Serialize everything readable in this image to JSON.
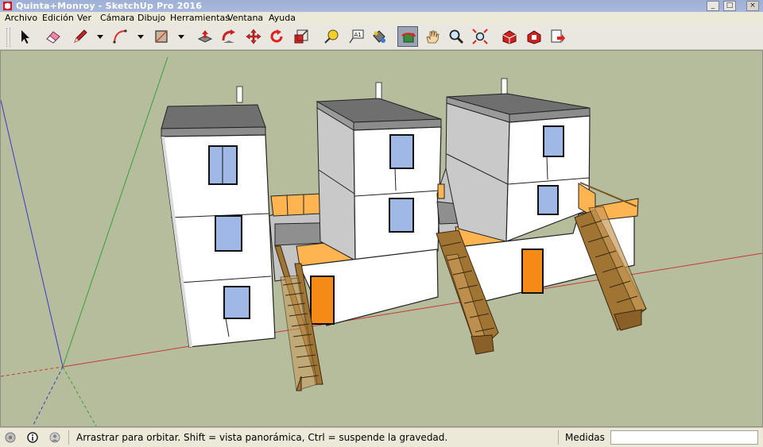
{
  "window": {
    "title": "Quinta+Monroy - SketchUp Pro 2016",
    "app_icon": "sketchup-logo",
    "controls": [
      "minimize",
      "maximize",
      "close"
    ],
    "control_glyphs": {
      "minimize": "_",
      "maximize": "□",
      "close": "×"
    }
  },
  "menu": {
    "items": [
      "Archivo",
      "Edición",
      "Ver",
      "Cámara",
      "Dibujo",
      "Herramientas",
      "Ventana",
      "Ayuda"
    ]
  },
  "toolbar": {
    "tools": [
      {
        "name": "select",
        "icon": "select-arrow-icon"
      },
      {
        "name": "eraser",
        "icon": "eraser-icon"
      },
      {
        "name": "line",
        "icon": "pencil-icon",
        "has_dropdown": true
      },
      {
        "name": "arc",
        "icon": "arc-icon",
        "has_dropdown": true
      },
      {
        "name": "rectangle",
        "icon": "rectangle-icon",
        "has_dropdown": true
      },
      {
        "name": "push-pull",
        "icon": "push-pull-icon"
      },
      {
        "name": "offset",
        "icon": "offset-icon"
      },
      {
        "name": "move",
        "icon": "move-icon"
      },
      {
        "name": "rotate",
        "icon": "rotate-icon"
      },
      {
        "name": "scale",
        "icon": "scale-icon"
      },
      {
        "name": "tape-measure",
        "icon": "tape-measure-icon"
      },
      {
        "name": "text",
        "icon": "text-icon",
        "label": "A1"
      },
      {
        "name": "paint-bucket",
        "icon": "paint-bucket-icon"
      },
      {
        "name": "orbit",
        "icon": "orbit-icon",
        "active": true
      },
      {
        "name": "pan",
        "icon": "pan-hand-icon"
      },
      {
        "name": "zoom",
        "icon": "zoom-icon"
      },
      {
        "name": "zoom-extents",
        "icon": "zoom-extents-icon"
      },
      {
        "name": "3d-warehouse",
        "icon": "warehouse-icon"
      },
      {
        "name": "extension-warehouse",
        "icon": "extension-warehouse-icon"
      },
      {
        "name": "layout",
        "icon": "send-to-layout-icon"
      }
    ]
  },
  "viewport": {
    "background": "#b6bd9d",
    "model": "Quinta+Monroy housing blocks"
  },
  "status": {
    "icons": [
      "geo-location-icon",
      "info-icon",
      "user-icon"
    ],
    "message": "Arrastrar para orbitar. Shift = vista panorámica, Ctrl = suspende la gravedad.",
    "measure_label": "Medidas",
    "measure_value": ""
  },
  "colors": {
    "wall": "#ffffff",
    "wall_shade": "#dcdcdc",
    "wall_dark": "#c4c4c4",
    "roof": "#6f6f6f",
    "roof_top": "#8c8c8c",
    "glass": "#9fb8e6",
    "door": "#f58a16",
    "railing": "#ffb452",
    "stairs": "#a07534",
    "ground": "#b6bd9d",
    "axis_red": "#c43a3a",
    "axis_green": "#35a235",
    "axis_blue": "#3a3ac4"
  }
}
